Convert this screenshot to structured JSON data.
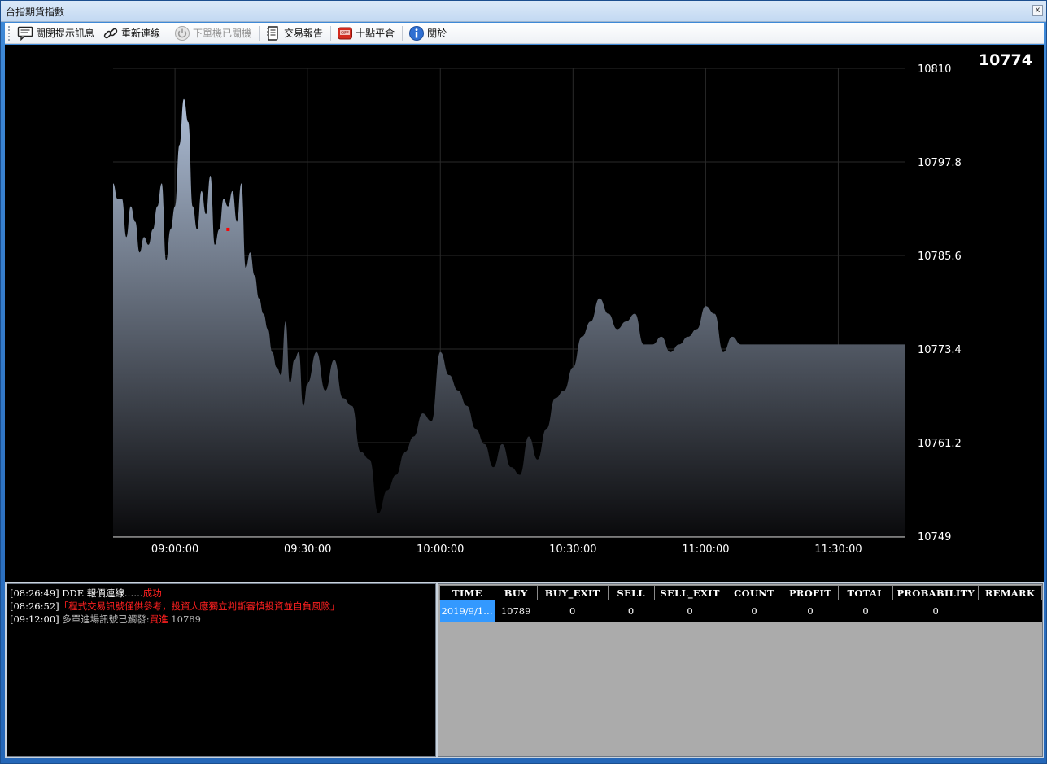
{
  "window": {
    "title": "台指期貨指數",
    "close_label": "x"
  },
  "toolbar": {
    "items": [
      {
        "label": "關閉提示訊息",
        "icon": "message-icon",
        "enabled": true
      },
      {
        "label": "重新連線",
        "icon": "link-icon",
        "enabled": true
      },
      {
        "label": "下單機已關機",
        "icon": "power-icon",
        "enabled": false
      },
      {
        "label": "交易報告",
        "icon": "report-icon",
        "enabled": true
      },
      {
        "label": "十點平倉",
        "icon": "exit-icon",
        "enabled": true
      },
      {
        "label": "關於",
        "icon": "info-icon",
        "enabled": true
      }
    ]
  },
  "chart": {
    "current_price": "10774",
    "colors": {
      "background": "#000000",
      "area_top": "#aebed6",
      "area_bottom": "#0a0a0c",
      "grid": "#2a2a2a",
      "marker": "#ff0000",
      "text": "#ffffff"
    }
  },
  "chart_data": {
    "type": "area",
    "ylim": [
      10749,
      10810
    ],
    "yticks": [
      "10810",
      "10797.8",
      "10785.6",
      "10773.4",
      "10761.2",
      "10749"
    ],
    "xlim": [
      "08:46:00",
      "11:45:00"
    ],
    "xticks": [
      "09:00:00",
      "09:30:00",
      "10:00:00",
      "10:30:00",
      "11:00:00",
      "11:30:00"
    ],
    "grid": true,
    "marker": {
      "x": "09:12:00",
      "y": 10789
    },
    "series": [
      {
        "x": [
          "08:46:00",
          "08:47:00",
          "08:48:00",
          "08:49:00",
          "08:50:00",
          "08:51:00",
          "08:52:00",
          "08:53:00",
          "08:54:00",
          "08:55:00",
          "08:56:00",
          "08:57:00",
          "08:58:00",
          "08:59:00",
          "09:00:00",
          "09:01:00",
          "09:02:00",
          "09:03:00",
          "09:04:00",
          "09:05:00",
          "09:06:00",
          "09:07:00",
          "09:08:00",
          "09:09:00",
          "09:10:00",
          "09:11:00",
          "09:12:00",
          "09:13:00",
          "09:14:00",
          "09:15:00",
          "09:16:00",
          "09:17:00",
          "09:18:00",
          "09:19:00",
          "09:20:00",
          "09:21:00",
          "09:22:00",
          "09:23:00",
          "09:24:00",
          "09:25:00",
          "09:26:00",
          "09:27:00",
          "09:28:00",
          "09:29:00",
          "09:30:00",
          "09:32:00",
          "09:34:00",
          "09:36:00",
          "09:38:00",
          "09:40:00",
          "09:42:00",
          "09:44:00",
          "09:46:00",
          "09:48:00",
          "09:50:00",
          "09:52:00",
          "09:54:00",
          "09:56:00",
          "09:58:00",
          "10:00:00",
          "10:02:00",
          "10:04:00",
          "10:06:00",
          "10:08:00",
          "10:10:00",
          "10:12:00",
          "10:14:00",
          "10:16:00",
          "10:18:00",
          "10:20:00",
          "10:22:00",
          "10:24:00",
          "10:26:00",
          "10:28:00",
          "10:30:00",
          "10:32:00",
          "10:34:00",
          "10:36:00",
          "10:38:00",
          "10:40:00",
          "10:42:00",
          "10:44:00",
          "10:46:00",
          "10:48:00",
          "10:50:00",
          "10:52:00",
          "10:54:00",
          "10:56:00",
          "10:58:00",
          "11:00:00",
          "11:02:00",
          "11:04:00",
          "11:06:00",
          "11:08:00",
          "11:10:00",
          "11:12:00",
          "11:14:00",
          "11:16:00",
          "11:18:00",
          "11:20:00",
          "11:22:00",
          "11:24:00",
          "11:26:00",
          "11:28:00",
          "11:30:00",
          "11:32:00",
          "11:34:00",
          "11:36:00",
          "11:38:00",
          "11:40:00",
          "11:42:00",
          "11:44:00",
          "11:45:00"
        ],
        "values": [
          10795,
          10793,
          10793,
          10788,
          10792,
          10790,
          10786,
          10788,
          10787,
          10789,
          10792,
          10795,
          10785,
          10789,
          10792,
          10800,
          10806,
          10803,
          10792,
          10789,
          10794,
          10791,
          10796,
          10787,
          10789,
          10793,
          10792,
          10794,
          10790,
          10795,
          10784,
          10786,
          10783,
          10780,
          10778,
          10776,
          10773,
          10771,
          10770,
          10777,
          10769,
          10772,
          10773,
          10766,
          10769,
          10773,
          10768,
          10772,
          10767,
          10766,
          10760,
          10759,
          10752,
          10755,
          10757,
          10760,
          10762,
          10765,
          10764,
          10773,
          10770,
          10768,
          10766,
          10763,
          10761,
          10758,
          10761,
          10758,
          10757,
          10762,
          10759,
          10763,
          10767,
          10768,
          10771,
          10775,
          10777,
          10780,
          10778,
          10776,
          10777,
          10778,
          10774,
          10774,
          10775,
          10773,
          10774,
          10775,
          10776,
          10779,
          10778,
          10773,
          10775,
          10774,
          10774,
          10774,
          10774,
          10774,
          10774,
          10774,
          10774,
          10774,
          10774,
          10774,
          10774,
          10774,
          10774,
          10774,
          10774,
          10774,
          10774,
          10774,
          10774
        ]
      }
    ]
  },
  "log": {
    "lines": [
      {
        "time": "[08:26:49]",
        "text": " DDE 報價連線……",
        "highlight": "成功",
        "extra": ""
      },
      {
        "time": "[08:26:52]",
        "text": "",
        "highlight": "「程式交易訊號僅供參考，投資人應獨立判斷審慎投資並自負風險」",
        "extra": ""
      },
      {
        "time": "[09:12:00]",
        "text": " 多單進場訊號已觸發:",
        "highlight": "買進",
        "extra": " 10789"
      }
    ]
  },
  "grid": {
    "columns": [
      "TIME",
      "BUY",
      "BUY_EXIT",
      "SELL",
      "SELL_EXIT",
      "COUNT",
      "PROFIT",
      "TOTAL",
      "PROBABILITY",
      "REMARK"
    ],
    "rows": [
      [
        "2019/9/1…",
        "10789",
        "0",
        "0",
        "0",
        "0",
        "0",
        "0",
        "0",
        ""
      ]
    ]
  }
}
